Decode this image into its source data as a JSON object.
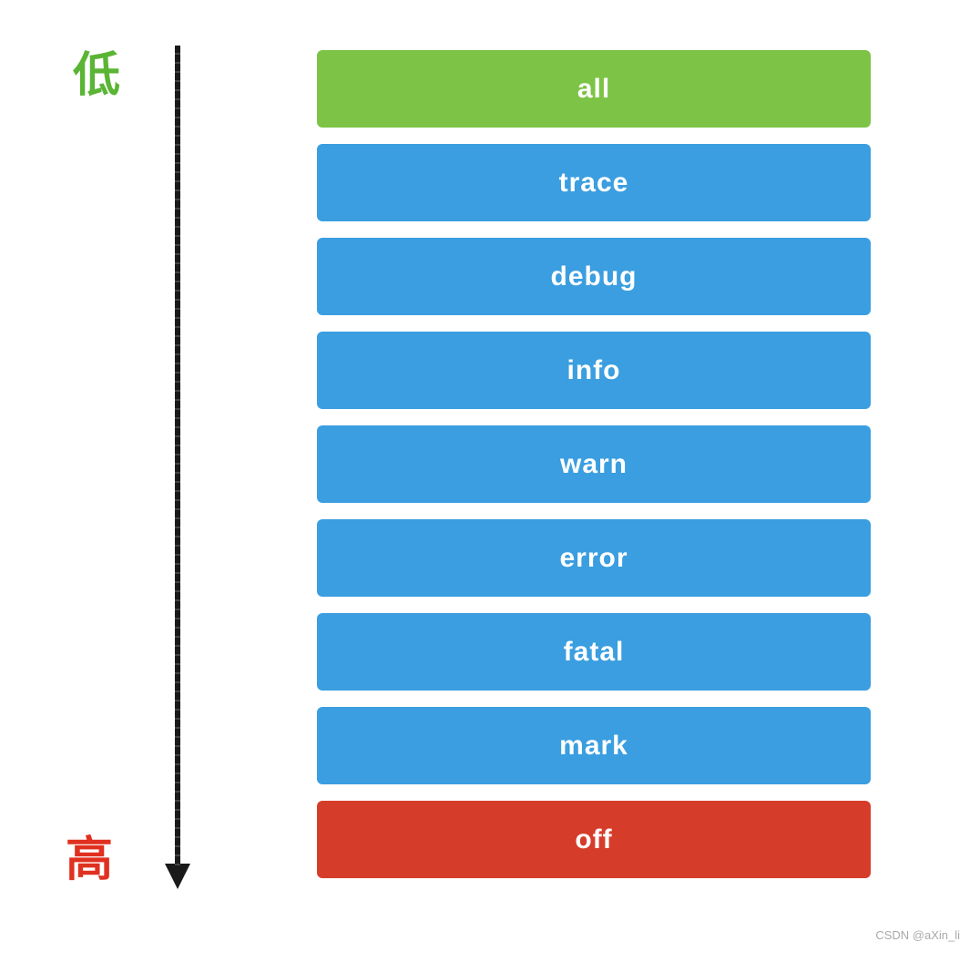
{
  "labels": {
    "low": "低",
    "high": "高"
  },
  "levels": [
    {
      "id": "all",
      "label": "all",
      "style": "bar-all"
    },
    {
      "id": "trace",
      "label": "trace",
      "style": "bar-blue"
    },
    {
      "id": "debug",
      "label": "debug",
      "style": "bar-blue"
    },
    {
      "id": "info",
      "label": "info",
      "style": "bar-blue"
    },
    {
      "id": "warn",
      "label": "warn",
      "style": "bar-blue"
    },
    {
      "id": "error",
      "label": "error",
      "style": "bar-blue"
    },
    {
      "id": "fatal",
      "label": "fatal",
      "style": "bar-blue"
    },
    {
      "id": "mark",
      "label": "mark",
      "style": "bar-blue"
    },
    {
      "id": "off",
      "label": "off",
      "style": "bar-off"
    }
  ],
  "watermark": "CSDN @aXin_li"
}
